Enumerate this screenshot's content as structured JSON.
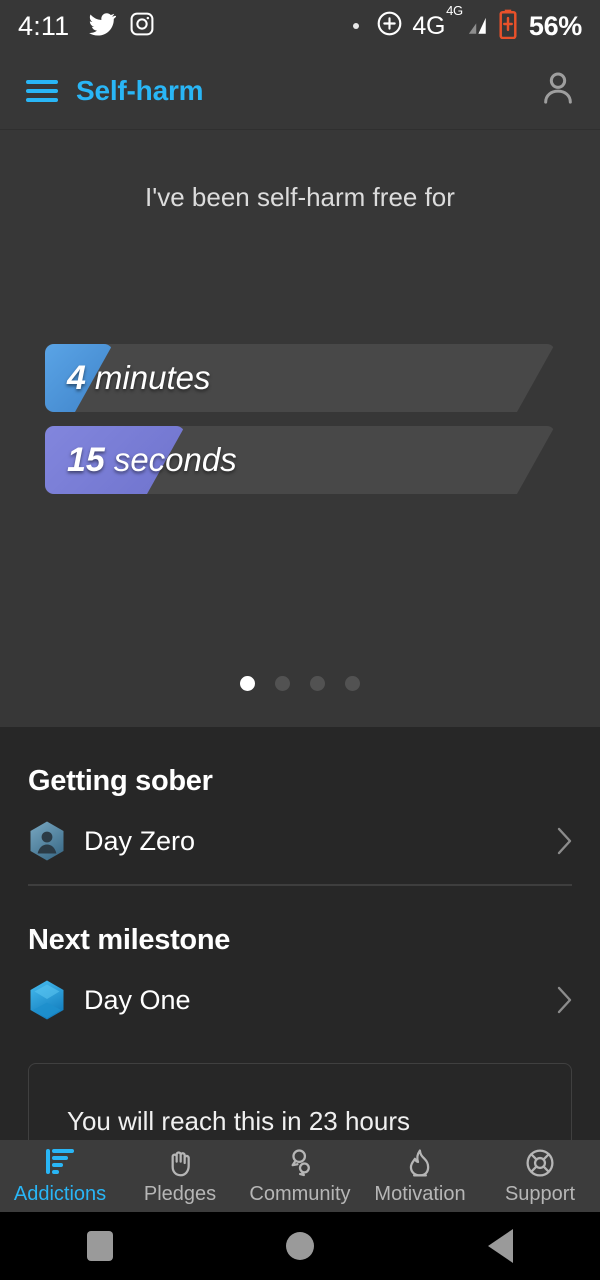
{
  "status_bar": {
    "time": "4:11",
    "left_icons": [
      "twitter-icon",
      "instagram-icon"
    ],
    "separator_dot": "•",
    "right_icons": [
      "circle-plus-icon",
      "signal-icon",
      "battery-charging-icon"
    ],
    "network": "4G",
    "network_sup": "4G",
    "battery_percent": "56%",
    "battery_color": "#e8512a"
  },
  "app_bar": {
    "menu_icon": "hamburger-menu-icon",
    "title": "Self-harm",
    "account_icon": "account-person-icon",
    "accent_color": "#29b6f6"
  },
  "hero": {
    "caption": "I've been self-harm free for",
    "bars": [
      {
        "value": "4",
        "unit": "minutes",
        "fill_percent": 13,
        "color": "#4a93d9"
      },
      {
        "value": "15",
        "unit": "seconds",
        "fill_percent": 27,
        "color": "#7a80d8"
      }
    ],
    "track_color": "#484848",
    "background": "#373737",
    "pager": {
      "count": 4,
      "active_index": 0
    }
  },
  "sections": [
    {
      "title": "Getting sober",
      "items": [
        {
          "label": "Day Zero",
          "badge_icon": "hexagon-person-badge-icon",
          "badge_color": "#5b8ca8",
          "chevron_icon": "chevron-right-icon"
        }
      ],
      "has_divider": true
    },
    {
      "title": "Next milestone",
      "items": [
        {
          "label": "Day One",
          "badge_icon": "hexagon-badge-icon",
          "badge_color": "#29a8e0",
          "chevron_icon": "chevron-right-icon"
        }
      ],
      "has_divider": false
    }
  ],
  "info_card": {
    "text": "You will reach this in 23 hours"
  },
  "bottom_nav": {
    "items": [
      {
        "label": "Addictions",
        "icon": "bar-chart-icon",
        "active": true
      },
      {
        "label": "Pledges",
        "icon": "raised-hand-icon",
        "active": false
      },
      {
        "label": "Community",
        "icon": "speech-bubbles-icon",
        "active": false
      },
      {
        "label": "Motivation",
        "icon": "flame-icon",
        "active": false
      },
      {
        "label": "Support",
        "icon": "lifebuoy-icon",
        "active": false
      }
    ],
    "active_color": "#29b6f6",
    "inactive_color": "#b6b6b6"
  },
  "system_nav": {
    "buttons": [
      {
        "name": "recents-button",
        "icon": "square-icon"
      },
      {
        "name": "home-button",
        "icon": "circle-icon"
      },
      {
        "name": "back-button",
        "icon": "triangle-left-icon"
      }
    ]
  }
}
